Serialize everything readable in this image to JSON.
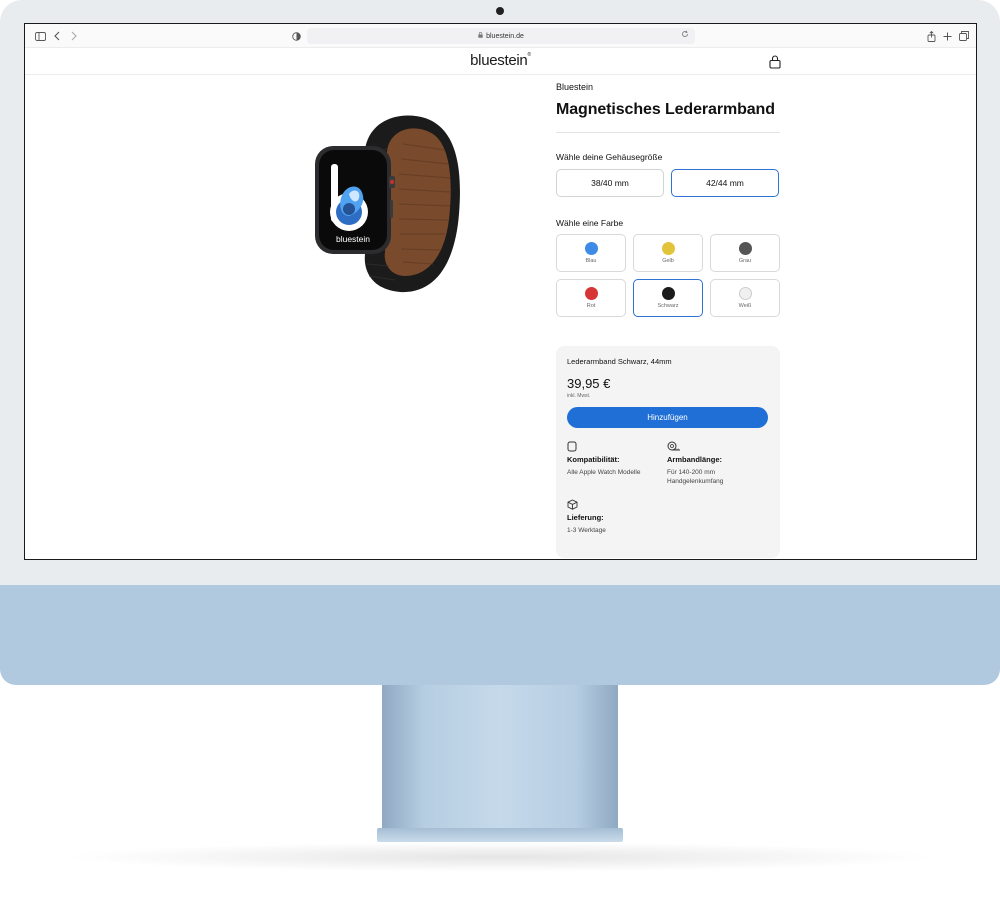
{
  "browser": {
    "url": "bluestein.de"
  },
  "header": {
    "brand": "bluestein"
  },
  "product": {
    "vendor": "Bluestein",
    "title": "Magnetisches Lederarmband",
    "watch_screen_text": "bluestein"
  },
  "size_section": {
    "label": "Wähle deine Gehäusegröße",
    "options": [
      "38/40 mm",
      "42/44 mm"
    ],
    "selected": "42/44 mm"
  },
  "color_section": {
    "label": "Wähle eine Farbe",
    "options": [
      {
        "name": "Blau",
        "color": "#3d8be6"
      },
      {
        "name": "Gelb",
        "color": "#e2c43a"
      },
      {
        "name": "Grau",
        "color": "#555555"
      },
      {
        "name": "Rot",
        "color": "#d63636"
      },
      {
        "name": "Schwarz",
        "color": "#1b1b1b"
      },
      {
        "name": "Weiß",
        "color": "#f0f0f0"
      }
    ],
    "selected": "Schwarz"
  },
  "buybox": {
    "variant": "Lederarmband Schwarz, 44mm",
    "price": "39,95 €",
    "tax_note": "inkl. Mwst.",
    "add_button": "Hinzufügen",
    "accent": "#1f6fd6",
    "info": {
      "compat_label": "Kompatibilität:",
      "compat_value": "Alle Apple Watch Modelle",
      "length_label": "Armbandlänge:",
      "length_value_1": "Für 140-200 mm",
      "length_value_2": "Handgelenkumfang",
      "delivery_label": "Lieferung:",
      "delivery_value": "1-3 Werktage"
    }
  }
}
